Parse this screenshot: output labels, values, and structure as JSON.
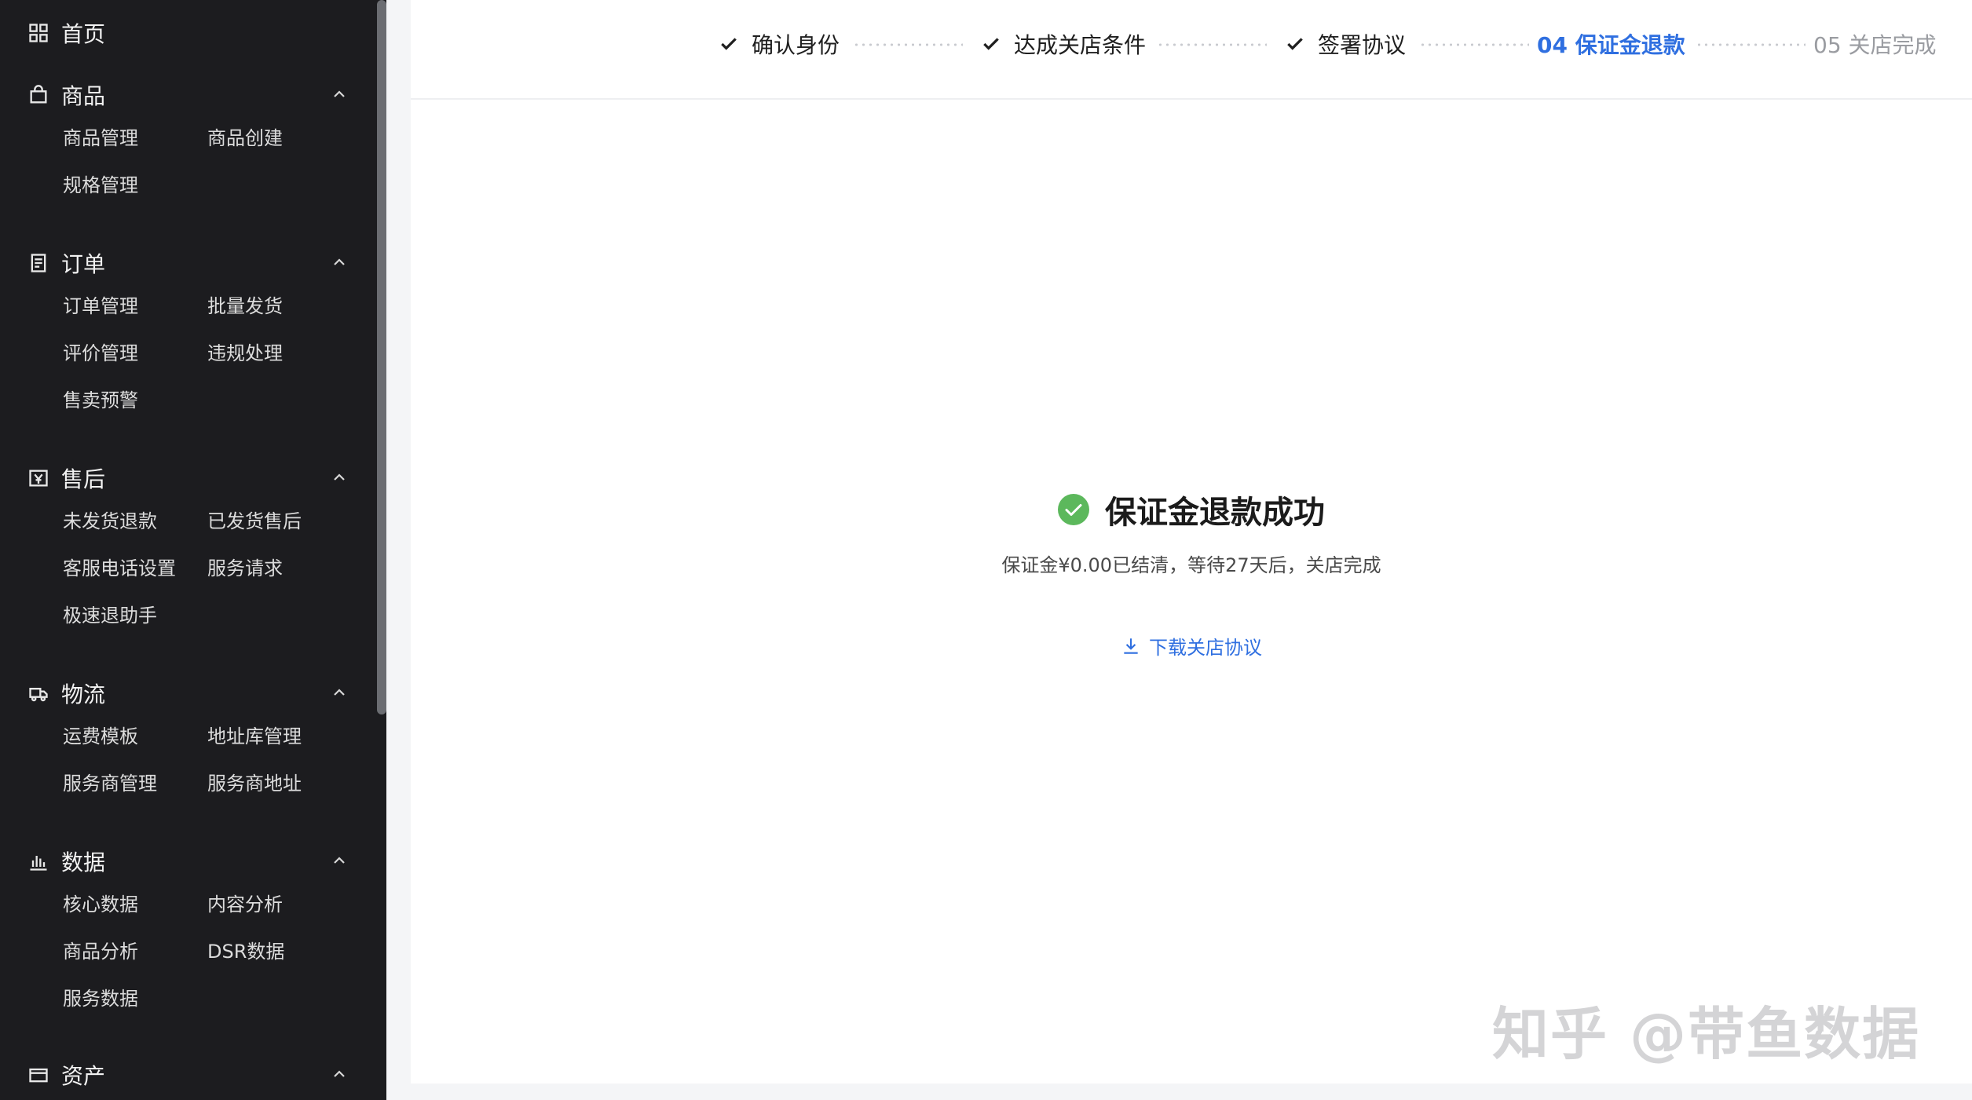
{
  "sidebar": {
    "home_label": "首页",
    "sections": [
      {
        "title": "商品",
        "icon": "bag-icon",
        "items": [
          "商品管理",
          "商品创建",
          "规格管理"
        ]
      },
      {
        "title": "订单",
        "icon": "document-icon",
        "items": [
          "订单管理",
          "批量发货",
          "评价管理",
          "违规处理",
          "售卖预警"
        ]
      },
      {
        "title": "售后",
        "icon": "yen-icon",
        "items": [
          "未发货退款",
          "已发货售后",
          "客服电话设置",
          "服务请求",
          "极速退助手"
        ]
      },
      {
        "title": "物流",
        "icon": "truck-icon",
        "items": [
          "运费模板",
          "地址库管理",
          "服务商管理",
          "服务商地址"
        ]
      },
      {
        "title": "数据",
        "icon": "bar-chart-icon",
        "items": [
          "核心数据",
          "内容分析",
          "商品分析",
          "DSR数据",
          "服务数据"
        ]
      },
      {
        "title": "资产",
        "icon": "wallet-icon",
        "items": []
      }
    ]
  },
  "steps": [
    {
      "label": "确认身份",
      "status": "done"
    },
    {
      "label": "达成关店条件",
      "status": "done"
    },
    {
      "label": "签署协议",
      "status": "done"
    },
    {
      "label": "04 保证金退款",
      "status": "active"
    },
    {
      "label": "05 关店完成",
      "status": "todo"
    }
  ],
  "result": {
    "title": "保证金退款成功",
    "description": "保证金¥0.00已结清，等待27天后，关店完成",
    "download_label": "下载关店协议"
  },
  "watermark": "知乎 @带鱼数据",
  "colors": {
    "accent": "#2f6fe0",
    "success": "#5cb85c",
    "sidebar_bg": "#1c1c1f"
  }
}
